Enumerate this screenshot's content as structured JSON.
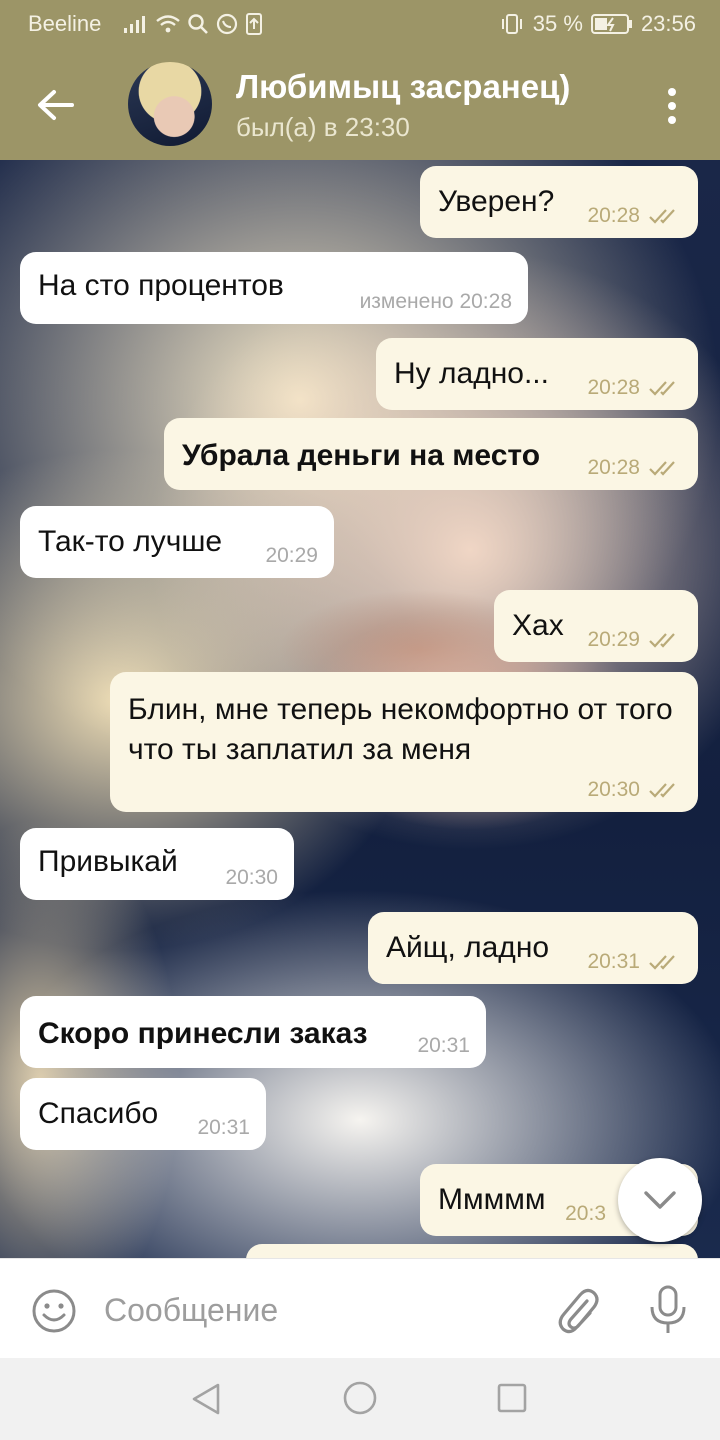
{
  "status_bar": {
    "carrier": "Beeline",
    "battery": "35 %",
    "time": "23:56"
  },
  "header": {
    "title": "Любимыц засранец)",
    "subtitle": "был(а) в 23:30"
  },
  "messages": [
    {
      "dir": "out",
      "text": "Уверен?",
      "time": "20:28"
    },
    {
      "dir": "in",
      "text": "На сто процентов",
      "time": "изменено 20:28"
    },
    {
      "dir": "out",
      "text": "Ну ладно...",
      "time": "20:28"
    },
    {
      "dir": "out",
      "text": "Убрала деньги на место",
      "time": "20:28"
    },
    {
      "dir": "in",
      "text": "Так-то лучше",
      "time": "20:29"
    },
    {
      "dir": "out",
      "text": "Хах",
      "time": "20:29"
    },
    {
      "dir": "out",
      "text": "Блин, мне теперь некомфортно от того что ты заплатил за меня",
      "time": "20:30"
    },
    {
      "dir": "in",
      "text": "Привыкай",
      "time": "20:30"
    },
    {
      "dir": "out",
      "text": "Айщ, ладно",
      "time": "20:31"
    },
    {
      "dir": "in",
      "text": "Скоро принесли заказ",
      "time": "20:31"
    },
    {
      "dir": "in",
      "text": "Спасибо",
      "time": "20:31"
    },
    {
      "dir": "out",
      "text": "Ммммм",
      "time": "20:3"
    }
  ],
  "composer": {
    "placeholder": "Сообщение"
  },
  "colors": {
    "header": "#9c9567",
    "bubble_out": "#fbf6e4",
    "bubble_in": "#ffffff",
    "tick": "#b9aa78"
  },
  "icons": {
    "back": "arrow-left-icon",
    "menu": "more-vertical-icon",
    "emoji": "smiley-icon",
    "attach": "paperclip-icon",
    "mic": "microphone-icon",
    "scroll": "chevron-down-icon",
    "read": "double-check-icon"
  }
}
